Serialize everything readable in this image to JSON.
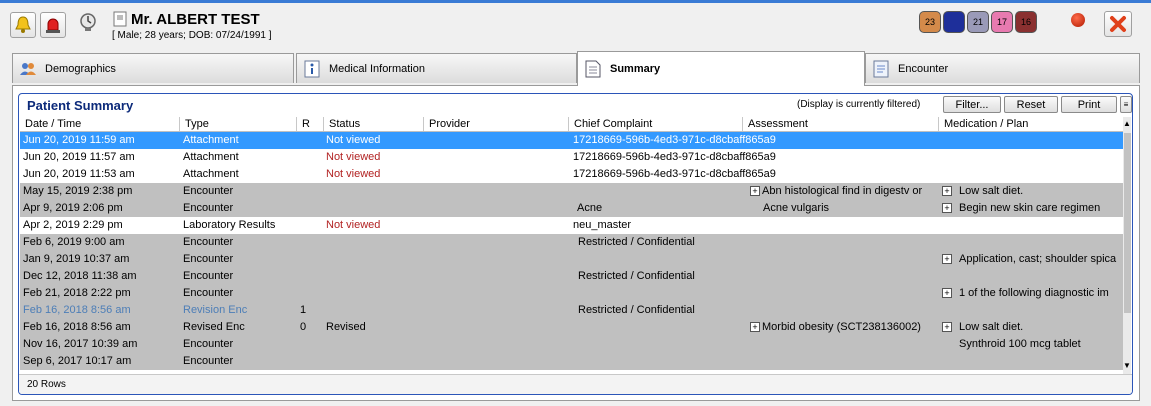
{
  "patient": {
    "name": "Mr. ALBERT  TEST",
    "demographics": "[ Male; 28 years; DOB: 07/24/1991 ]"
  },
  "badges": [
    {
      "label": "23",
      "color": "#d48a4a"
    },
    {
      "label": "",
      "color": "#1e2f9a"
    },
    {
      "label": "21",
      "color": "#9a9ab8"
    },
    {
      "label": "17",
      "color": "#e87ab0"
    },
    {
      "label": "16",
      "color": "#8a3030"
    }
  ],
  "tabs": [
    {
      "label": "Demographics",
      "icon": "people-icon"
    },
    {
      "label": "Medical Information",
      "icon": "info-icon"
    },
    {
      "label": "Summary",
      "icon": "document-icon"
    },
    {
      "label": "Encounter",
      "icon": "form-icon"
    }
  ],
  "summary": {
    "title": "Patient Summary",
    "filter_status": "(Display is currently filtered)",
    "filter_button": "Filter...",
    "reset_button": "Reset",
    "print_button": "Print",
    "row_count": "20 Rows"
  },
  "columns": [
    "Date / Time",
    "Type",
    "R",
    "Status",
    "Provider",
    "Chief Complaint",
    "Assessment",
    "Medication / Plan"
  ],
  "rows": [
    {
      "date": "Jun 20, 2019 11:59 am",
      "type": "Attachment",
      "r": "",
      "status": "Not viewed",
      "provider": "",
      "complaint": "17218669-596b-4ed3-971c-d8cbaff865a9",
      "assessment": "",
      "plan": ""
    },
    {
      "date": "Jun 20, 2019 11:57 am",
      "type": "Attachment",
      "r": "",
      "status": "Not viewed",
      "provider": "",
      "complaint": "17218669-596b-4ed3-971c-d8cbaff865a9",
      "assessment": "",
      "plan": ""
    },
    {
      "date": "Jun 20, 2019 11:53 am",
      "type": "Attachment",
      "r": "",
      "status": "Not viewed",
      "provider": "",
      "complaint": "17218669-596b-4ed3-971c-d8cbaff865a9",
      "assessment": "",
      "plan": ""
    },
    {
      "date": "May 15, 2019 2:38 pm",
      "type": "Encounter",
      "r": "",
      "status": "",
      "provider": "",
      "complaint": "",
      "assessment": "Abn histological find in digestv or",
      "plan": "Low salt diet."
    },
    {
      "date": "Apr 9, 2019 2:06 pm",
      "type": "Encounter",
      "r": "",
      "status": "",
      "provider": "",
      "complaint": "Acne",
      "assessment": "Acne vulgaris",
      "plan": "Begin new skin care regimen"
    },
    {
      "date": "Apr 2, 2019 2:29 pm",
      "type": "Laboratory Results",
      "r": "",
      "status": "Not viewed",
      "provider": "",
      "complaint": "neu_master",
      "assessment": "",
      "plan": ""
    },
    {
      "date": "Feb 6, 2019 9:00 am",
      "type": "Encounter",
      "r": "",
      "status": "",
      "provider": "",
      "complaint": "Restricted / Confidential",
      "assessment": "",
      "plan": ""
    },
    {
      "date": "Jan 9, 2019 10:37 am",
      "type": "Encounter",
      "r": "",
      "status": "",
      "provider": "",
      "complaint": "",
      "assessment": "",
      "plan": "Application, cast; shoulder spica"
    },
    {
      "date": "Dec 12, 2018 11:38 am",
      "type": "Encounter",
      "r": "",
      "status": "",
      "provider": "",
      "complaint": "Restricted / Confidential",
      "assessment": "",
      "plan": ""
    },
    {
      "date": "Feb 21, 2018 2:22 pm",
      "type": "Encounter",
      "r": "",
      "status": "",
      "provider": "",
      "complaint": "",
      "assessment": "",
      "plan": "1 of the following diagnostic im"
    },
    {
      "date": "Feb 16, 2018 8:56 am",
      "type": "Revision Enc",
      "r": "1",
      "status": "",
      "provider": "",
      "complaint": "Restricted / Confidential",
      "assessment": "",
      "plan": ""
    },
    {
      "date": "Feb 16, 2018 8:56 am",
      "type": "Revised Enc",
      "r": "0",
      "status": "Revised",
      "provider": "",
      "complaint": "",
      "assessment": "Morbid obesity (SCT238136002)",
      "plan": "Low salt diet."
    },
    {
      "date": "Nov 16, 2017 10:39 am",
      "type": "Encounter",
      "r": "",
      "status": "",
      "provider": "",
      "complaint": "",
      "assessment": "",
      "plan": "Synthroid 100 mcg tablet"
    },
    {
      "date": "Sep 6, 2017 10:17 am",
      "type": "Encounter",
      "r": "",
      "status": "",
      "provider": "",
      "complaint": "",
      "assessment": "",
      "plan": ""
    }
  ]
}
